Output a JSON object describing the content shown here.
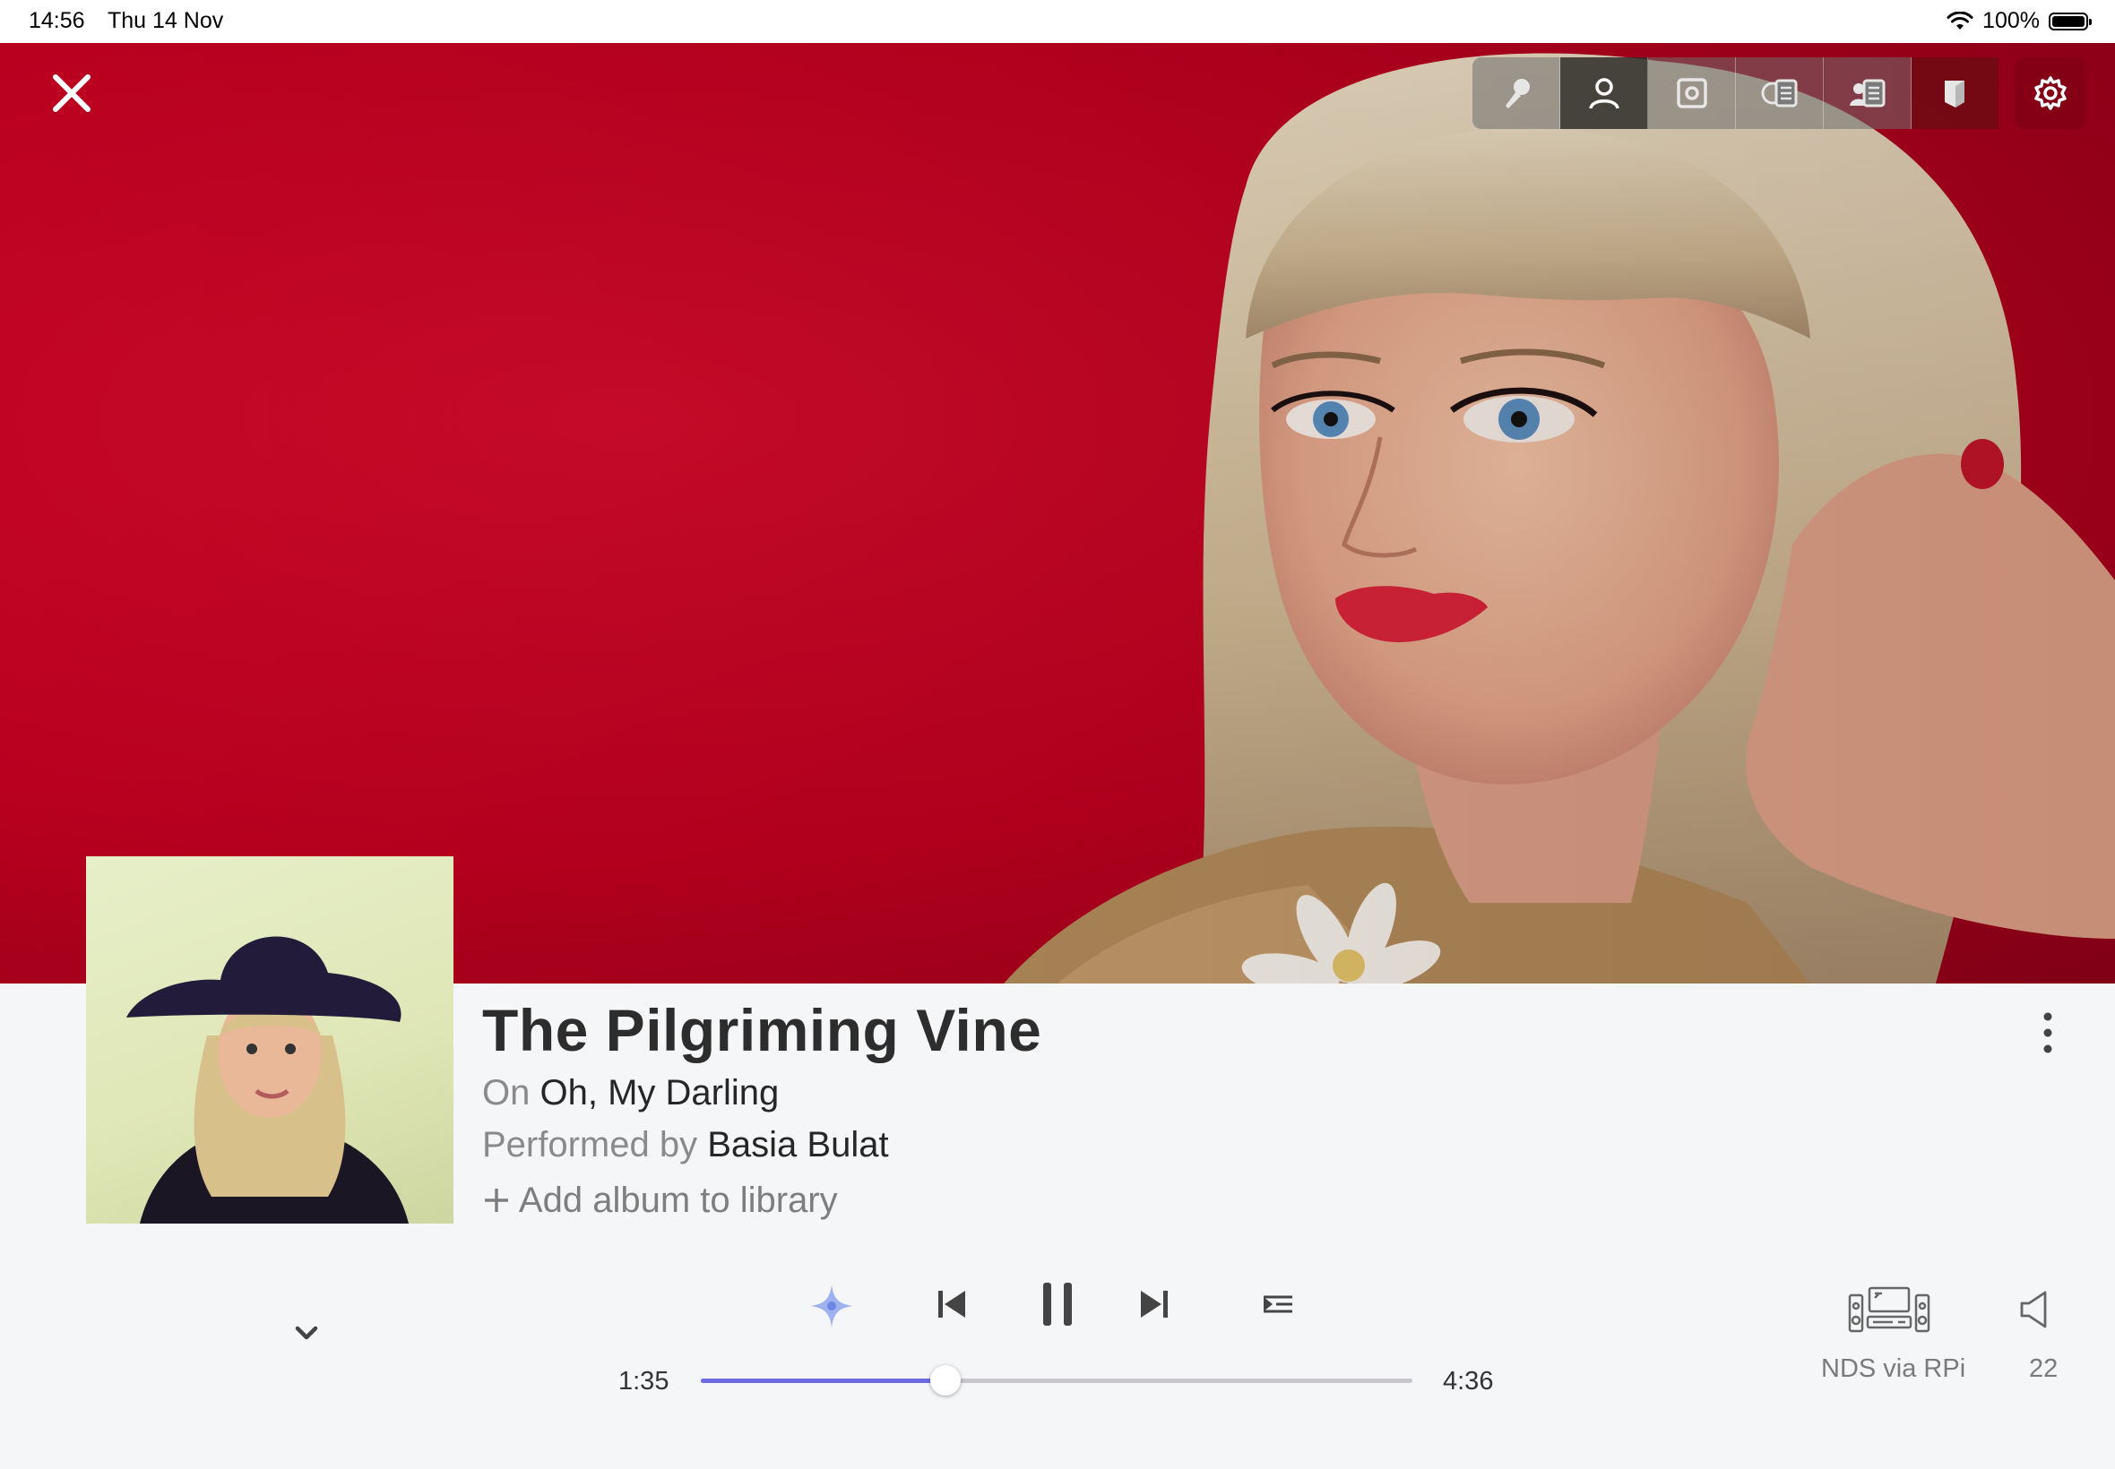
{
  "status_bar": {
    "time": "14:56",
    "date": "Thu 14 Nov",
    "battery_percent": "100%"
  },
  "toolbar": {
    "buttons": [
      {
        "icon": "microphone-icon",
        "active": false
      },
      {
        "icon": "artist-icon",
        "active": true
      },
      {
        "icon": "album-icon",
        "active": false
      },
      {
        "icon": "album-info-icon",
        "active": false
      },
      {
        "icon": "artist-info-icon",
        "active": false
      },
      {
        "icon": "book-icon",
        "active": false
      }
    ],
    "settings_icon": "gear-icon"
  },
  "track": {
    "title": "The Pilgriming Vine",
    "album_prefix": "On",
    "album": "Oh, My Darling",
    "artist_prefix": "Performed by",
    "artist": "Basia Bulat",
    "add_to_library": "Add album to library"
  },
  "player": {
    "elapsed": "1:35",
    "duration": "4:36",
    "progress_fraction": 0.344,
    "device_name": "NDS via RPi",
    "volume": "22"
  },
  "colors": {
    "hero_red": "#b9001f",
    "accent": "#6d6ae2",
    "text_dark": "#2d2d2d",
    "text_muted": "#8a8a8a"
  }
}
